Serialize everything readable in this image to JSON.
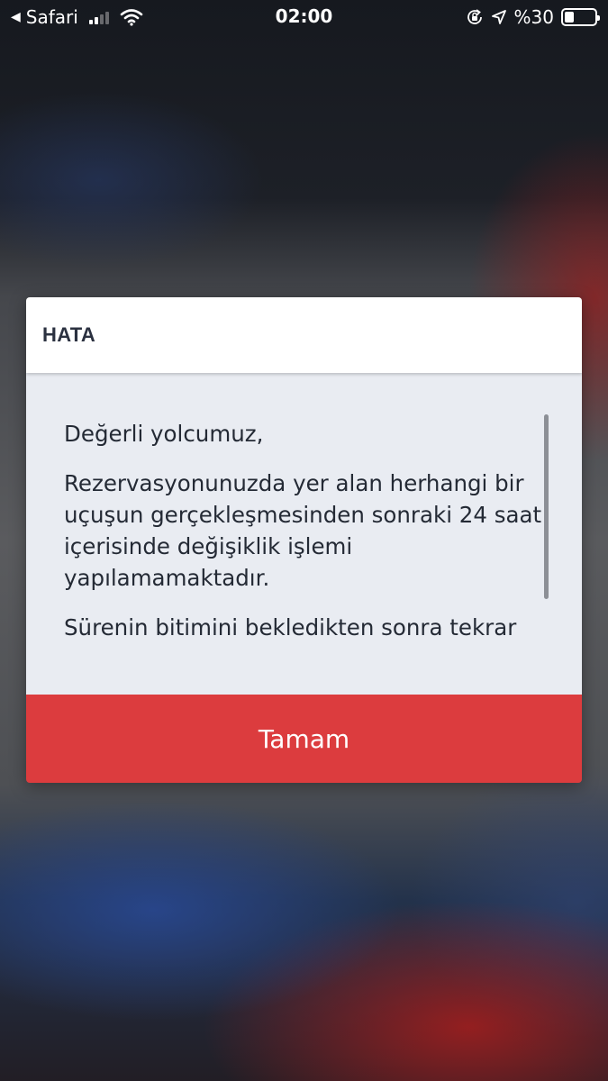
{
  "status_bar": {
    "back_app": "Safari",
    "time": "02:00",
    "battery_text": "%30",
    "battery_level": 0.3,
    "signal_bars": 2,
    "icons": [
      "back-arrow-icon",
      "signal-icon",
      "wifi-icon",
      "rotation-lock-icon",
      "location-arrow-icon",
      "battery-icon"
    ]
  },
  "dialog": {
    "title": "HATA",
    "paragraphs": [
      "Değerli yolcumuz,",
      "Rezervasyonunuzda yer alan herhangi bir uçuşun gerçekleşmesinden sonraki 24 saat içerisinde değişiklik işlemi yapılamamaktadır.",
      "Sürenin bitimini bekledikten sonra tekrar"
    ],
    "ok_label": "Tamam"
  },
  "colors": {
    "accent": "#dc3c3e",
    "dialog_body": "#e9ecf2",
    "title_text": "#2b3140"
  }
}
